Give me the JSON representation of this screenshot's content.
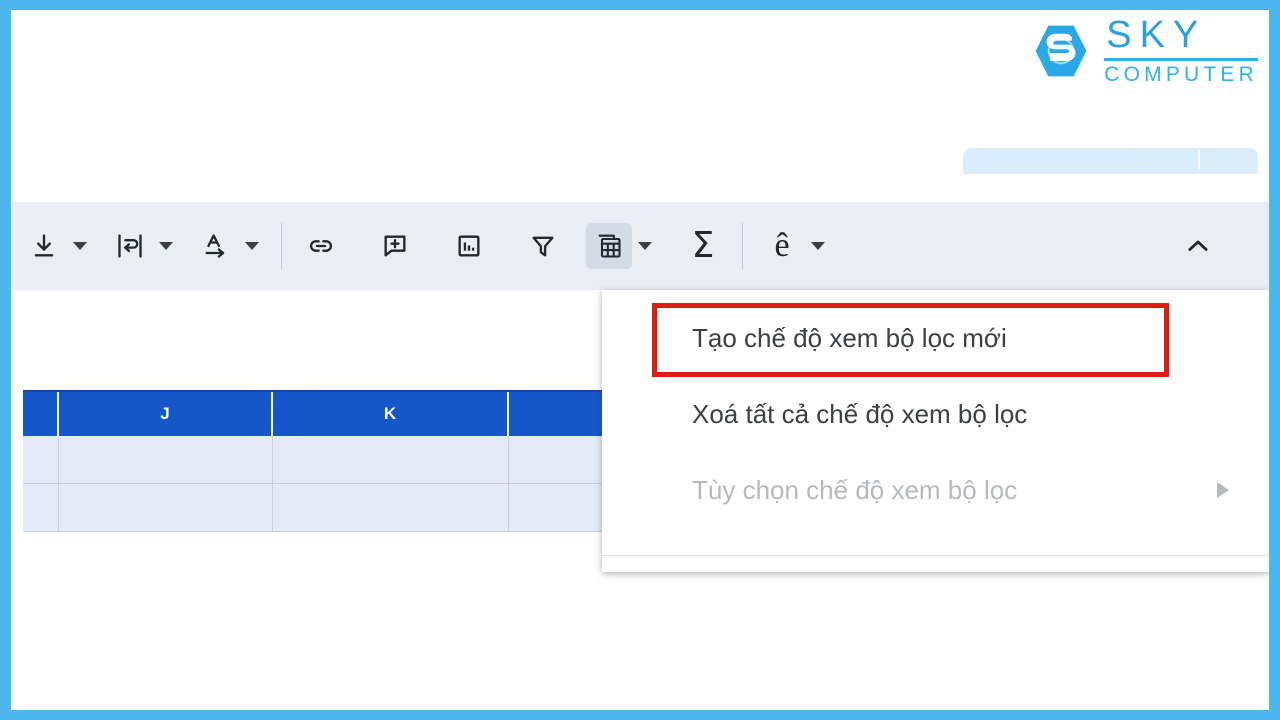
{
  "brand": {
    "name": "SKY",
    "tagline": "COMPUTER",
    "logo_icon": "sky-hexagon-s-logo",
    "accent_color": "#2fb2e8"
  },
  "frame": {
    "border_color": "#4cb7ec"
  },
  "toolbar": {
    "background_color": "#eaeef4",
    "items": [
      {
        "icon": "vertical-align-bottom-icon",
        "label": "Căn dọc",
        "has_caret": true,
        "active": false
      },
      {
        "icon": "text-wrap-icon",
        "label": "Xuống dòng văn bản",
        "has_caret": true,
        "active": false
      },
      {
        "icon": "text-rotation-icon",
        "label": "Xoay văn bản",
        "has_caret": true,
        "active": false
      },
      {
        "icon": "insert-link-icon",
        "label": "Chèn đường liên kết",
        "has_caret": false,
        "active": false
      },
      {
        "icon": "insert-comment-icon",
        "label": "Chèn nhận xét",
        "has_caret": false,
        "active": false
      },
      {
        "icon": "insert-chart-icon",
        "label": "Chèn biểu đồ",
        "has_caret": false,
        "active": false
      },
      {
        "icon": "filter-funnel-icon",
        "label": "Tạo bộ lọc",
        "has_caret": false,
        "active": false
      },
      {
        "icon": "filter-views-icon",
        "label": "Chế độ xem bộ lọc",
        "has_caret": true,
        "active": true
      },
      {
        "icon": "functions-sigma-icon",
        "label": "Hàm",
        "has_caret": false,
        "active": false
      },
      {
        "icon": "input-tools-e-icon",
        "label": "Công cụ nhập liệu",
        "has_caret": true,
        "active": false
      }
    ],
    "collapse": {
      "icon": "chevron-up-icon",
      "label": "Thu gọn thanh công cụ"
    }
  },
  "menu": {
    "name": "filter-views-menu",
    "items": [
      {
        "label": "Tạo chế độ xem bộ lọc mới",
        "disabled": false,
        "highlighted": true,
        "has_submenu": false
      },
      {
        "label": "Xoá tất cả chế độ xem bộ lọc",
        "disabled": false,
        "highlighted": false,
        "has_submenu": false
      },
      {
        "label": "Tùy chọn chế độ xem bộ lọc",
        "disabled": true,
        "highlighted": false,
        "has_submenu": true
      }
    ],
    "highlight_color": "#e01b12"
  },
  "sheet": {
    "header_color": "#1557cb",
    "cell_fill_color": "#e5eaf8",
    "columns": [
      "",
      "J",
      "K",
      ""
    ],
    "rows": [
      [
        "",
        "",
        "",
        ""
      ],
      [
        "",
        "",
        "",
        ""
      ]
    ]
  }
}
